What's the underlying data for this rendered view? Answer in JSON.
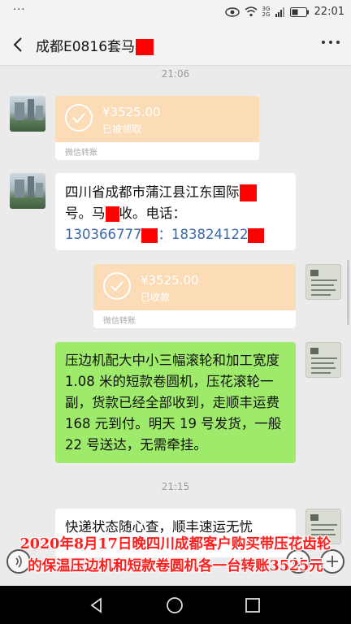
{
  "status_bar": {
    "dots": "···",
    "network": "3G 2G",
    "time": "22:01"
  },
  "header": {
    "title": "成都E0816套马"
  },
  "messages": {
    "time1": "21:06",
    "transfer1": {
      "amount": "¥3525.00",
      "status": "已被领取",
      "label": "微信转账"
    },
    "address": {
      "line1": "四川省成都市蒲江县江东国际",
      "line2a": "号。马",
      "line2b": "收。电话：",
      "phone1": "130366777",
      "sep": "：",
      "phone2": "183824122"
    },
    "transfer2": {
      "amount": "¥3525.00",
      "status": "已收款",
      "label": "微信转账"
    },
    "order": "压边机配大中小三幅滚轮和加工宽度 1.08 米的短款卷圆机，压花滚轮一副，货款已经全部收到，走顺丰运费 168 元到付。明天 19 号发货，一般 22 号送达，无需牵挂。",
    "time2": "21:15",
    "last": "快递状态随心查，顺丰速运无忧"
  },
  "caption": {
    "line1": "2020年8月17日晚四川成都客户购买带压花齿轮",
    "line2": "的保温压边机和短款卷圆机各一台转账3525元"
  },
  "colors": {
    "redact": "#ff0000",
    "green_bubble": "#9eea6a",
    "transfer": "#fbdcb6",
    "caption": "#ff1e1e",
    "phone": "#3d6aa7"
  }
}
